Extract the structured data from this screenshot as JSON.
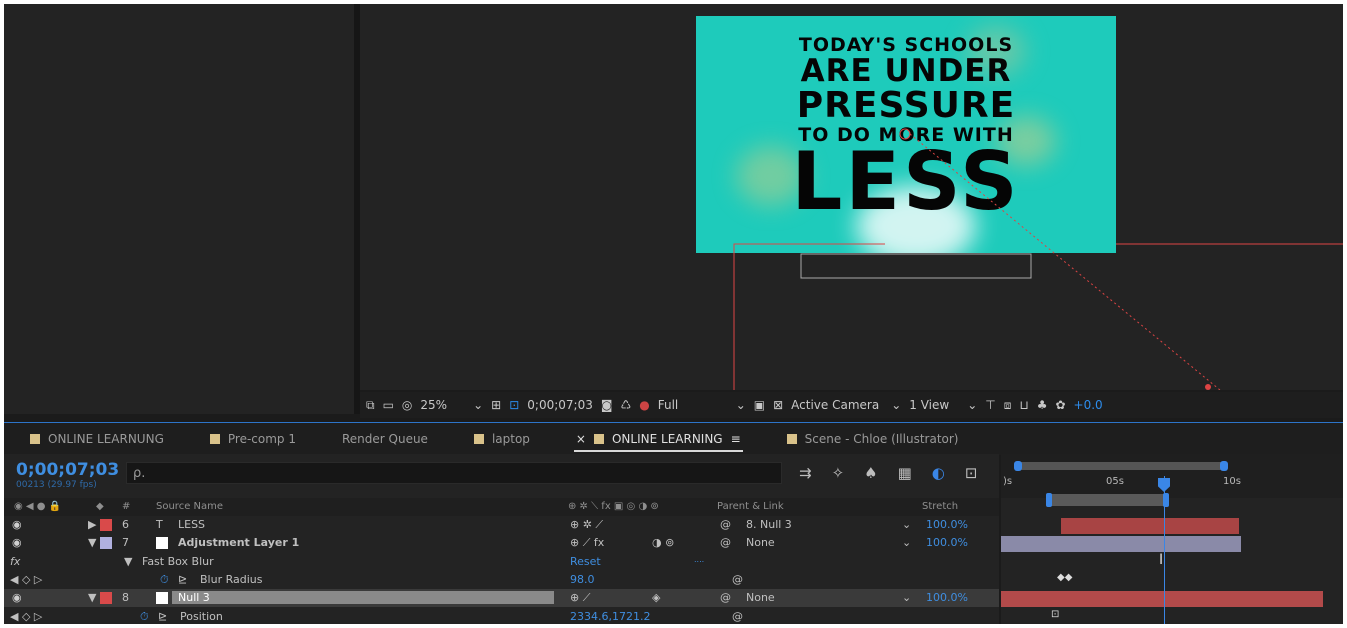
{
  "comp": {
    "lines": [
      "TODAY'S SCHOOLS",
      "ARE UNDER",
      "PRESSURE",
      "TO DO MORE WITH",
      "LESS"
    ],
    "bg_color": "#1ecbbb"
  },
  "viewer_toolbar": {
    "zoom": "25%",
    "timecode": "0;00;07;03",
    "resolution": "Full",
    "camera": "Active Camera",
    "views": "1 View",
    "exposure": "+0.0"
  },
  "tabs": [
    {
      "label": "ONLINE LEARNUNG",
      "color": "#d9c28a"
    },
    {
      "label": "Pre-comp 1",
      "color": "#d9c28a"
    },
    {
      "label": "Render Queue",
      "color": ""
    },
    {
      "label": "laptop",
      "color": "#d9c28a"
    },
    {
      "label": "ONLINE LEARNING",
      "color": "#d9c28a",
      "close": "×",
      "menu": "≡"
    },
    {
      "label": "Scene - Chloe (Illustrator)",
      "color": "#d9c28a"
    }
  ],
  "timeline": {
    "timecode": "0;00;07;03",
    "frames": "00213 (29.97 fps)",
    "search_placeholder": "ρ.",
    "columns": {
      "num": "#",
      "source": "Source Name",
      "parent": "Parent & Link",
      "stretch": "Stretch"
    },
    "layers": [
      {
        "num": "6",
        "name": "LESS",
        "type_icon": "T",
        "label_color": "#d94a4a",
        "parent": "8. Null 3",
        "stretch": "100.0%"
      },
      {
        "num": "7",
        "name": "Adjustment Layer 1",
        "label_color": "#b1b1e0",
        "parent": "None",
        "stretch": "100.0%"
      },
      {
        "num": "8",
        "name": "Null 3",
        "label_color": "#d94a4a",
        "parent": "None",
        "stretch": "100.0%"
      }
    ],
    "effect": {
      "name": "Fast Box Blur",
      "reset": "Reset",
      "dots": "...."
    },
    "blur_radius": {
      "name": "Blur Radius",
      "value": "98.0"
    },
    "position": {
      "name": "Position",
      "value": "2334.6,1721.2"
    }
  },
  "ruler": {
    "labels": [
      ")s",
      "05s",
      "10s"
    ]
  }
}
